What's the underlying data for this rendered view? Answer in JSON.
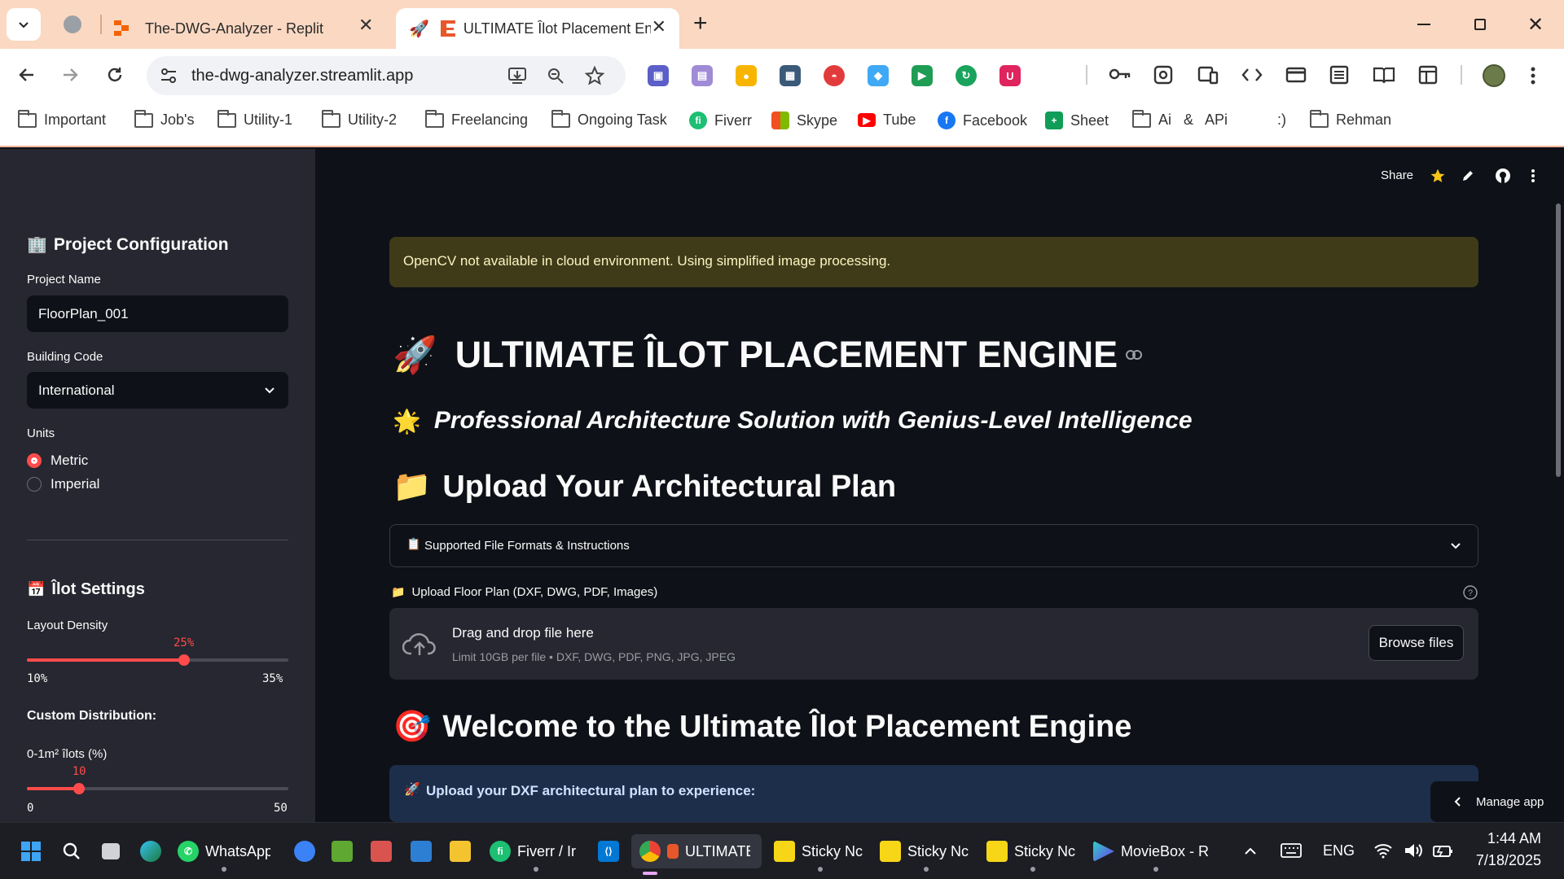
{
  "browser": {
    "tabs": [
      {
        "label": "The-DWG-Analyzer - Replit"
      },
      {
        "label": "ULTIMATE Îlot Placement En"
      }
    ],
    "url": "the-dwg-analyzer.streamlit.app",
    "bookmarks": [
      "Important",
      "Job's",
      "Utility-1",
      "Utility-2",
      "Freelancing",
      "Ongoing Task",
      "Fiverr",
      "Skype",
      "Tube",
      "Facebook",
      "Sheet",
      "Ai   &   APi",
      ":)",
      "Rehman"
    ]
  },
  "app_header": {
    "share_label": "Share"
  },
  "sidebar": {
    "project_config_title": "Project Configuration",
    "project_name_label": "Project Name",
    "project_name_value": "FloorPlan_001",
    "building_code_label": "Building Code",
    "building_code_value": "International",
    "units_label": "Units",
    "units_options": [
      "Metric",
      "Imperial"
    ],
    "units_selected": "Metric",
    "ilot_settings_title": "Îlot Settings",
    "layout_density_label": "Layout Density",
    "layout_density_value": "25%",
    "layout_density_fraction": 0.6,
    "layout_density_min": "10%",
    "layout_density_max": "35%",
    "custom_distribution_label": "Custom Distribution:",
    "dist_0_1_label": "0-1m² îlots (%)",
    "dist_0_1_value": "10",
    "dist_0_1_fraction": 0.2,
    "dist_0_1_min": "0",
    "dist_0_1_max": "50"
  },
  "main": {
    "alert_text": "OpenCV not available in cloud environment. Using simplified image processing.",
    "title": "ULTIMATE ÎLOT PLACEMENT ENGINE",
    "subtitle": "Professional Architecture Solution with Genius-Level Intelligence",
    "upload_heading": "Upload Your Architectural Plan",
    "expander_label": "Supported File Formats & Instructions",
    "uploader_label": "Upload Floor Plan (DXF, DWG, PDF, Images)",
    "dropzone_title": "Drag and drop file here",
    "dropzone_limit": "Limit 10GB per file • DXF, DWG, PDF, PNG, JPG, JPEG",
    "browse_label": "Browse files",
    "welcome_heading": "Welcome to the Ultimate Îlot Placement Engine",
    "info_text": "Upload your DXF architectural plan to experience:",
    "manage_app_label": "Manage app"
  },
  "taskbar": {
    "items": [
      "WhatsApp",
      "Fiverr / Ir",
      "ULTIMATE",
      "Sticky Nc",
      "Sticky Nc",
      "Sticky Nc",
      "MovieBox - R"
    ],
    "language": "ENG",
    "time": "1:44 AM",
    "date": "7/18/2025"
  }
}
